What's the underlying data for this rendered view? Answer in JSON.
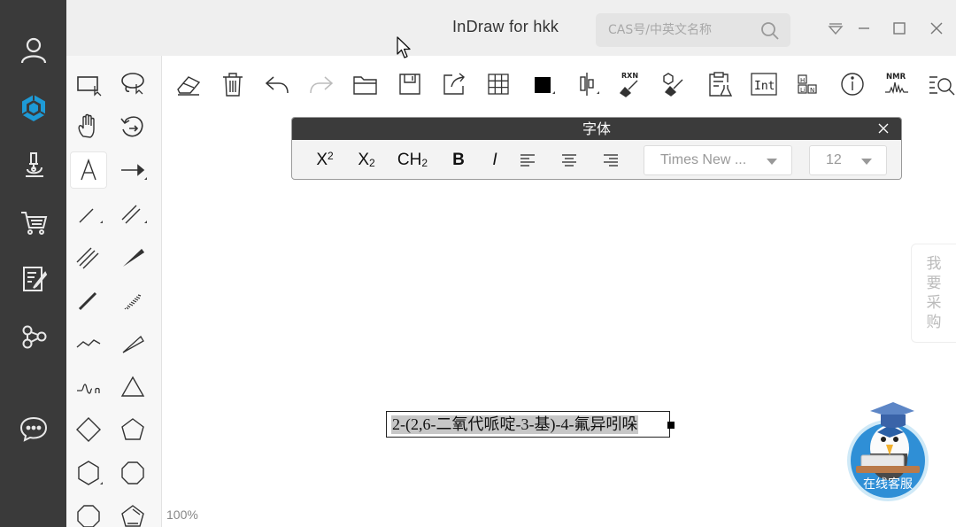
{
  "window": {
    "title": "InDraw for hkk",
    "search_placeholder": "CAS号/中英文名称"
  },
  "sidebar": {
    "items": [
      {
        "name": "user-icon"
      },
      {
        "name": "indraw-logo-icon"
      },
      {
        "name": "microscope-icon"
      },
      {
        "name": "shopping-cart-icon"
      },
      {
        "name": "notes-icon"
      },
      {
        "name": "share-icon"
      },
      {
        "name": "chat-icon"
      }
    ]
  },
  "toolbar": {
    "rxn_label": "RXN",
    "int_label": "Int",
    "nmr_label": "NMR"
  },
  "font_dialog": {
    "title": "字体",
    "superscript_label": "X",
    "superscript_mark": "2",
    "subscript_label": "X",
    "subscript_mark": "2",
    "ch2_label": "CH",
    "ch2_mark": "2",
    "bold_label": "B",
    "italic_label": "I",
    "font_family": "Times New ...",
    "font_size": "12"
  },
  "canvas": {
    "label_text": "2-(2,6-二氧代哌啶-3-基)-4-氟异吲哚",
    "zoom": "100%"
  },
  "buy_tab": {
    "chars": [
      "我",
      "要",
      "采",
      "购"
    ]
  },
  "service": {
    "label": "在线客服"
  },
  "colors": {
    "sidebar_bg": "#3a3a3a",
    "accent": "#1e9ad6",
    "titlebar_bg": "#efefef"
  }
}
